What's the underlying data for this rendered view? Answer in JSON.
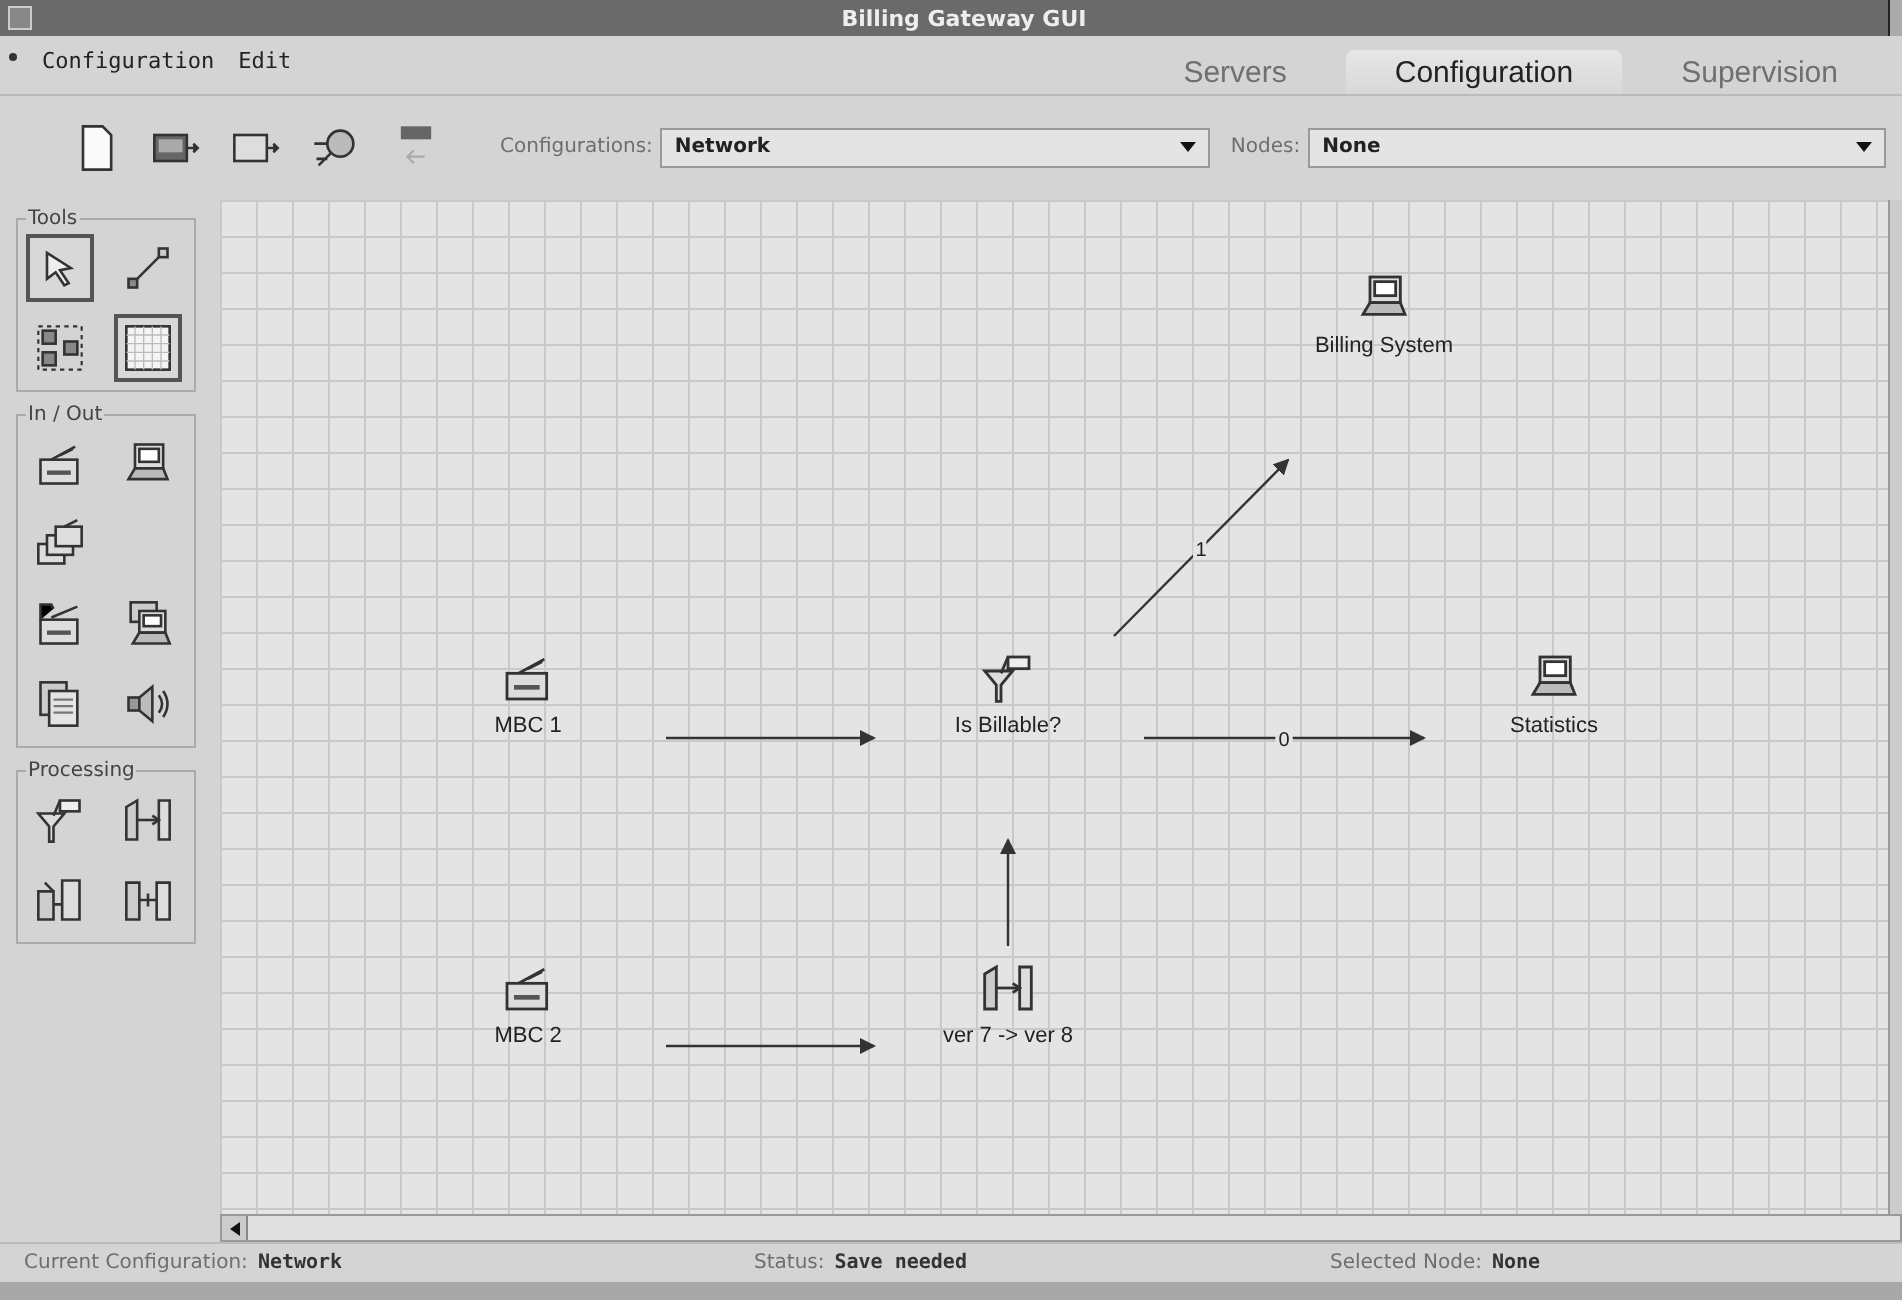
{
  "window": {
    "title": "Billing Gateway GUI"
  },
  "menu": [
    {
      "label": "Configuration"
    },
    {
      "label": "Edit"
    }
  ],
  "tabs": [
    {
      "label": "Servers",
      "selected": false
    },
    {
      "label": "Configuration",
      "selected": true
    },
    {
      "label": "Supervision",
      "selected": false
    }
  ],
  "toolbar": {
    "configurations": {
      "label": "Configurations:",
      "value": "Network"
    },
    "nodes": {
      "label": "Nodes:",
      "value": "None"
    }
  },
  "palette": [
    {
      "title": "Tools",
      "items": [
        {
          "kind": "pointer",
          "selected": true
        },
        {
          "kind": "connector",
          "selected": false
        },
        {
          "kind": "group",
          "selected": false
        },
        {
          "kind": "grid",
          "selected": true
        }
      ]
    },
    {
      "title": "In / Out",
      "items": [
        {
          "kind": "collector"
        },
        {
          "kind": "computer"
        },
        {
          "kind": "collectors"
        },
        {
          "kind": "collector-folder"
        },
        {
          "kind": "computer-stack"
        },
        {
          "kind": "documents"
        },
        {
          "kind": "speaker"
        }
      ]
    },
    {
      "title": "Processing",
      "items": [
        {
          "kind": "filter"
        },
        {
          "kind": "converter"
        },
        {
          "kind": "splitter"
        },
        {
          "kind": "merger"
        }
      ]
    }
  ],
  "diagram": {
    "nodes": [
      {
        "kind": "computer",
        "label": "Billing System"
      },
      {
        "kind": "collector",
        "label": "MBC 1"
      },
      {
        "kind": "filter",
        "label": "Is Billable?"
      },
      {
        "kind": "computer",
        "label": "Statistics"
      },
      {
        "kind": "collector",
        "label": "MBC 2"
      },
      {
        "kind": "converter",
        "label": "ver 7 -> ver 8"
      }
    ],
    "edges": [
      {
        "kind": "arrow"
      },
      {
        "kind": "arrow",
        "label": "0"
      },
      {
        "kind": "arrow",
        "label": "1"
      },
      {
        "kind": "arrow"
      },
      {
        "kind": "arrow"
      }
    ]
  },
  "status_bar": [
    {
      "label": "Current Configuration:",
      "value": "Network"
    },
    {
      "label": "Status:",
      "value": "Save needed"
    },
    {
      "label": "Selected Node:",
      "value": "None"
    }
  ]
}
